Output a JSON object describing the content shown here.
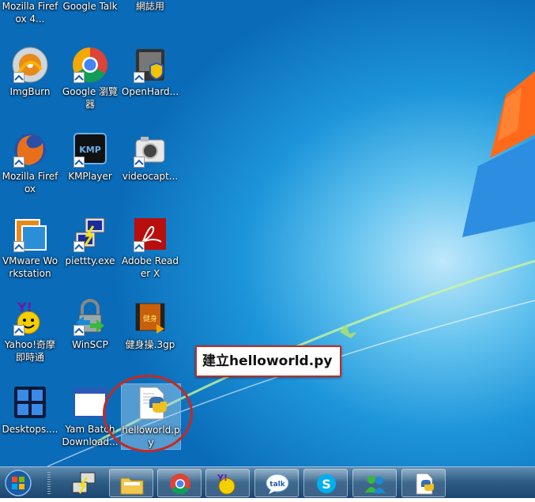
{
  "desktop": {
    "icons": [
      {
        "label": "Mozilla Firefox 4..."
      },
      {
        "label": "Google Talk"
      },
      {
        "label": "網誌用"
      },
      {
        "label": "ImgBurn"
      },
      {
        "label": "Google 瀏覽器"
      },
      {
        "label": "OpenHard..."
      },
      {
        "label": "Mozilla Firefox"
      },
      {
        "label": "KMPlayer"
      },
      {
        "label": "videocapt..."
      },
      {
        "label": "VMware Workstation"
      },
      {
        "label": "piettty.exe"
      },
      {
        "label": "Adobe Reader X"
      },
      {
        "label": "Yahoo!奇摩即時通"
      },
      {
        "label": "WinSCP"
      },
      {
        "label": "健身操.3gp"
      },
      {
        "label": "Desktops...."
      },
      {
        "label": "Yam Batch Download..."
      },
      {
        "label": "helloworld.py"
      }
    ]
  },
  "annotation": {
    "text": "建立helloworld.py"
  },
  "taskbar": {
    "items": [
      {
        "icon": "putty-icon"
      },
      {
        "icon": "folder-icon"
      },
      {
        "icon": "chrome-icon"
      },
      {
        "icon": "yahoo-messenger-icon"
      },
      {
        "icon": "google-talk-icon"
      },
      {
        "icon": "skype-icon"
      },
      {
        "icon": "users-icon"
      },
      {
        "icon": "python-file-icon"
      }
    ]
  },
  "colors": {
    "annotation_border": "#c8281e",
    "taskbar": "#2f5e86",
    "desktop": "#1d95da"
  }
}
